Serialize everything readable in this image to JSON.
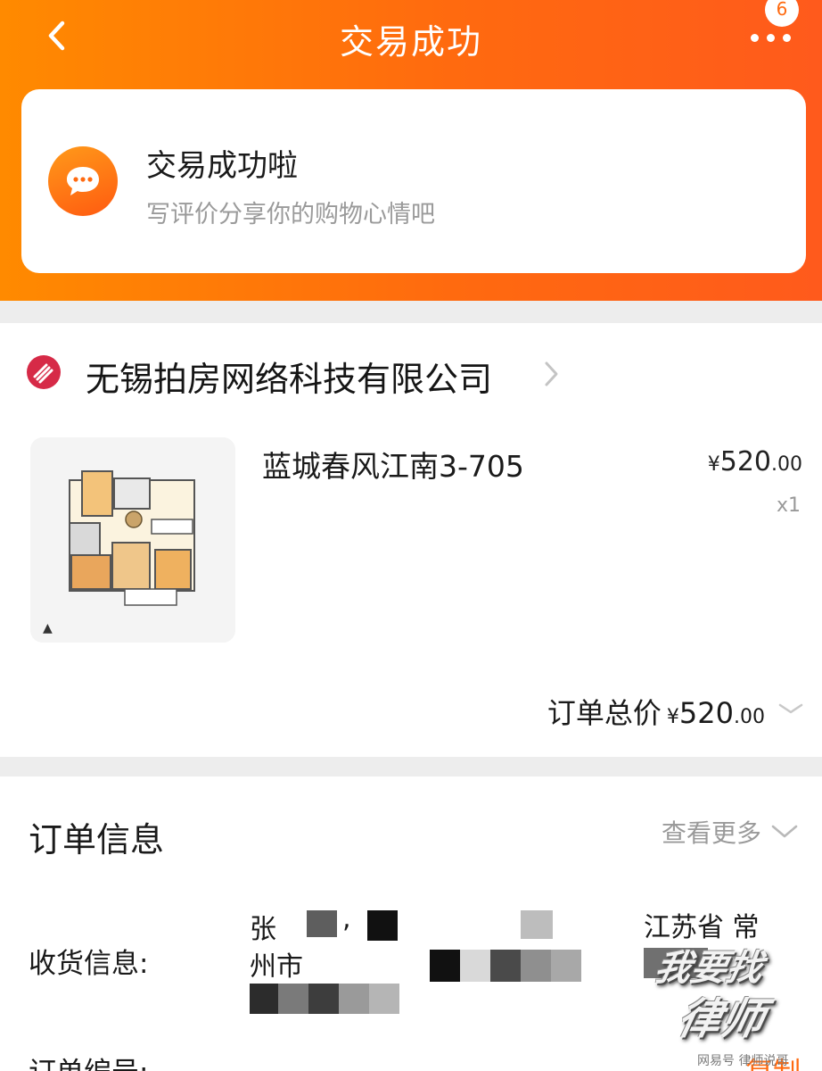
{
  "colors": {
    "brand_orange": "#ff6a10",
    "header_gradient": [
      "#ff8a00",
      "#ff5a1c"
    ],
    "shop_logo_red": "#d62a47"
  },
  "header": {
    "title": "交易成功",
    "back_icon": "chevron-left-icon",
    "more_icon": "more-dots-icon",
    "notification_count": "6"
  },
  "success_card": {
    "icon": "chat-bubble-icon",
    "title": "交易成功啦",
    "subtitle": "写评价分享你的购物心情吧"
  },
  "order": {
    "shop_name": "无锡拍房网络科技有限公司",
    "product": {
      "title": "蓝城春风江南3-705",
      "thumbnail": "floor-plan-image",
      "price_currency": "¥",
      "price_int": "520",
      "price_dec": ".00",
      "quantity": "x1"
    },
    "total": {
      "label": "订单总价",
      "currency": "¥",
      "amount_int": "520",
      "amount_dec": ".00"
    }
  },
  "order_info": {
    "title": "订单信息",
    "view_more": "查看更多",
    "shipping_label": "收货信息:",
    "shipping_line1_start": "张",
    "shipping_line1_comma": ",",
    "shipping_line1_end": "江苏省 常",
    "shipping_line2_start": "州市",
    "order_no_label": "订单编号:",
    "copy_label": "复制"
  },
  "watermark": {
    "line1": "我要找",
    "line2": "律师",
    "source": "网易号 律师说哥"
  }
}
